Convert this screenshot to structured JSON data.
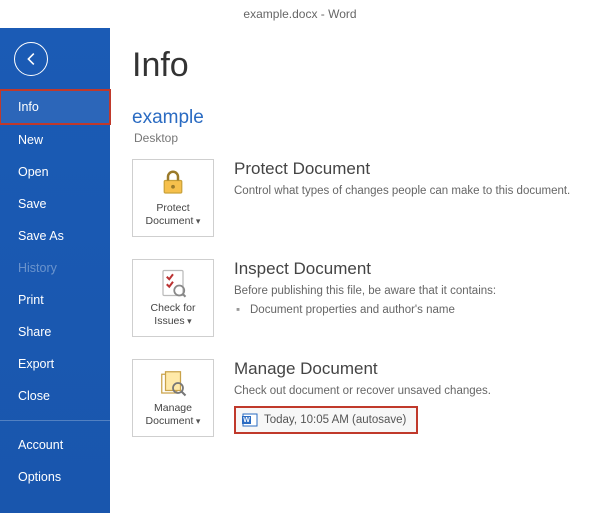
{
  "titlebar": "example.docx - Word",
  "sidebar": {
    "items": [
      {
        "label": "Info",
        "selected": true
      },
      {
        "label": "New"
      },
      {
        "label": "Open"
      },
      {
        "label": "Save"
      },
      {
        "label": "Save As"
      },
      {
        "label": "History",
        "disabled": true
      },
      {
        "label": "Print"
      },
      {
        "label": "Share"
      },
      {
        "label": "Export"
      },
      {
        "label": "Close"
      }
    ],
    "footer": [
      {
        "label": "Account"
      },
      {
        "label": "Options"
      }
    ]
  },
  "main": {
    "page_title": "Info",
    "doc_name": "example",
    "doc_location": "Desktop",
    "sections": {
      "protect": {
        "tile_label": "Protect Document",
        "title": "Protect Document",
        "desc": "Control what types of changes people can make to this document."
      },
      "inspect": {
        "tile_label": "Check for Issues",
        "title": "Inspect Document",
        "desc": "Before publishing this file, be aware that it contains:",
        "issues": [
          "Document properties and author's name"
        ]
      },
      "manage": {
        "tile_label": "Manage Document",
        "title": "Manage Document",
        "desc": "Check out document or recover unsaved changes.",
        "autosave": "Today, 10:05 AM (autosave)"
      }
    }
  }
}
